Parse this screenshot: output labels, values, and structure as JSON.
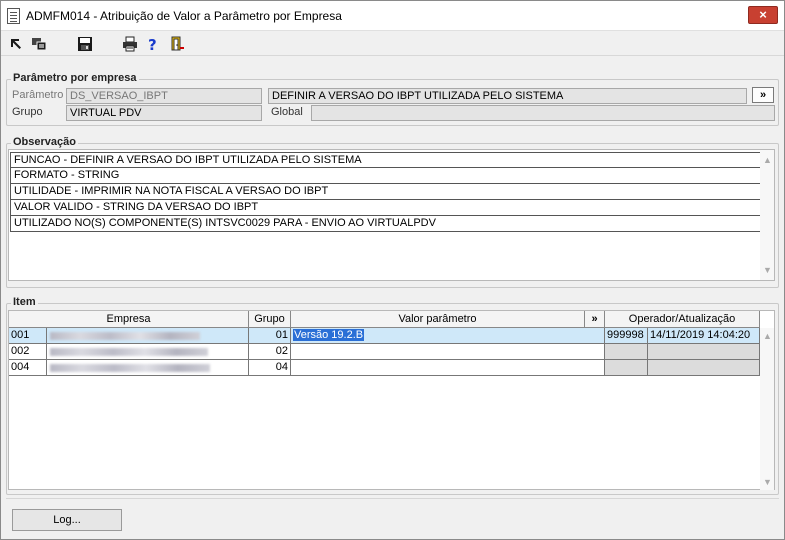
{
  "window": {
    "title": "ADMFM014 - Atribuição de Valor a Parâmetro por Empresa",
    "close_label": "×"
  },
  "toolbar": {
    "icons": [
      "exit-icon",
      "windows-icon",
      "save-icon",
      "print-icon",
      "help-icon",
      "door-exit-icon"
    ]
  },
  "parametro_group": {
    "label": "Parâmetro por empresa",
    "parametro_label": "Parâmetro",
    "parametro_value": "DS_VERSAO_IBPT",
    "descricao_value": "DEFINIR A VERSAO DO IBPT UTILIZADA PELO SISTEMA",
    "expand_label": "»",
    "grupo_label": "Grupo",
    "grupo_value": "VIRTUAL PDV",
    "global_label": "Global",
    "global_value": ""
  },
  "observacao": {
    "label": "Observação",
    "lines": [
      "FUNCAO - DEFINIR A VERSAO DO IBPT UTILIZADA PELO SISTEMA",
      "FORMATO - STRING",
      "UTILIDADE - IMPRIMIR NA NOTA FISCAL A VERSAO DO IBPT",
      "VALOR VALIDO - STRING DA VERSAO DO IBPT",
      "UTILIZADO NO(S) COMPONENTE(S) INTSVC0029  PARA  - ENVIO AO VIRTUALPDV"
    ]
  },
  "item": {
    "label": "Item",
    "headers": {
      "empresa": "Empresa",
      "grupo": "Grupo",
      "valor": "Valor parâmetro",
      "expand": "»",
      "operador": "Operador/Atualização"
    },
    "rows": [
      {
        "code": "001",
        "grupo": "01",
        "valor": "Versão 19.2.B",
        "operador": "999998",
        "atualizacao": "14/11/2019 14:04:20",
        "selected": true
      },
      {
        "code": "002",
        "grupo": "02",
        "valor": "",
        "operador": "",
        "atualizacao": "",
        "selected": false
      },
      {
        "code": "004",
        "grupo": "04",
        "valor": "",
        "operador": "",
        "atualizacao": "",
        "selected": false
      }
    ]
  },
  "footer": {
    "log_label": "Log..."
  },
  "colors": {
    "selected_row": "#cfe8f9",
    "selected_text_bg": "#2a6fd6",
    "close_button": "#c84031"
  }
}
